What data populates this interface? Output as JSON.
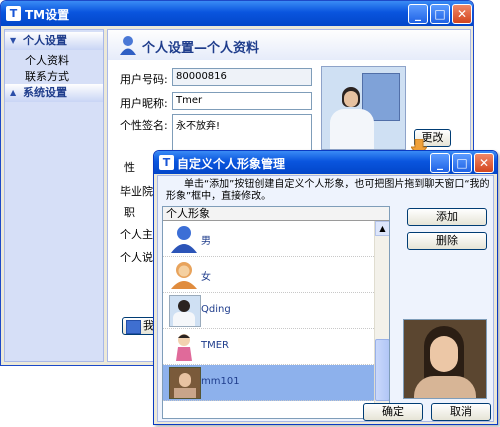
{
  "main_window": {
    "title": "TM设置",
    "sidebar": {
      "groups": [
        {
          "label": "个人设置",
          "items": [
            "个人资料",
            "联系方式"
          ]
        },
        {
          "label": "系统设置",
          "items": []
        }
      ]
    },
    "page_title": "个人设置—个人资料",
    "form": {
      "user_id_label": "用户号码:",
      "user_id_value": "80000816",
      "nickname_label": "用户昵称:",
      "nickname_value": "Tmer",
      "signature_label": "个性签名:",
      "signature_value": "永不放弃!",
      "change_button": "更改",
      "gender_label": "性",
      "school_label": "毕业院",
      "job_label": "职",
      "homepage_label": "个人主",
      "description_label": "个人说",
      "bottom_button_partial": "我"
    }
  },
  "dialog": {
    "title": "自定义个人形象管理",
    "instructions": "单击“添加”按钮创建自定义个人形象，也可把图片拖到聊天窗口“我的形象”框中，直接修改。",
    "list_header": "个人形象",
    "items": [
      {
        "name": "男",
        "icon": "male-avatar-icon"
      },
      {
        "name": "女",
        "icon": "female-avatar-icon"
      },
      {
        "name": "Qding",
        "icon": "photo-avatar"
      },
      {
        "name": "TMER",
        "icon": "cartoon-avatar"
      },
      {
        "name": "mm101",
        "icon": "photo-avatar",
        "selected": true
      }
    ],
    "add_button": "添加",
    "delete_button": "删除",
    "ok_button": "确定",
    "cancel_button": "取消"
  },
  "colors": {
    "titlebar": "#0a55de",
    "accent_text": "#1f3d8c",
    "selected_row": "#8db1ec",
    "window_bg": "#ece9d8"
  }
}
